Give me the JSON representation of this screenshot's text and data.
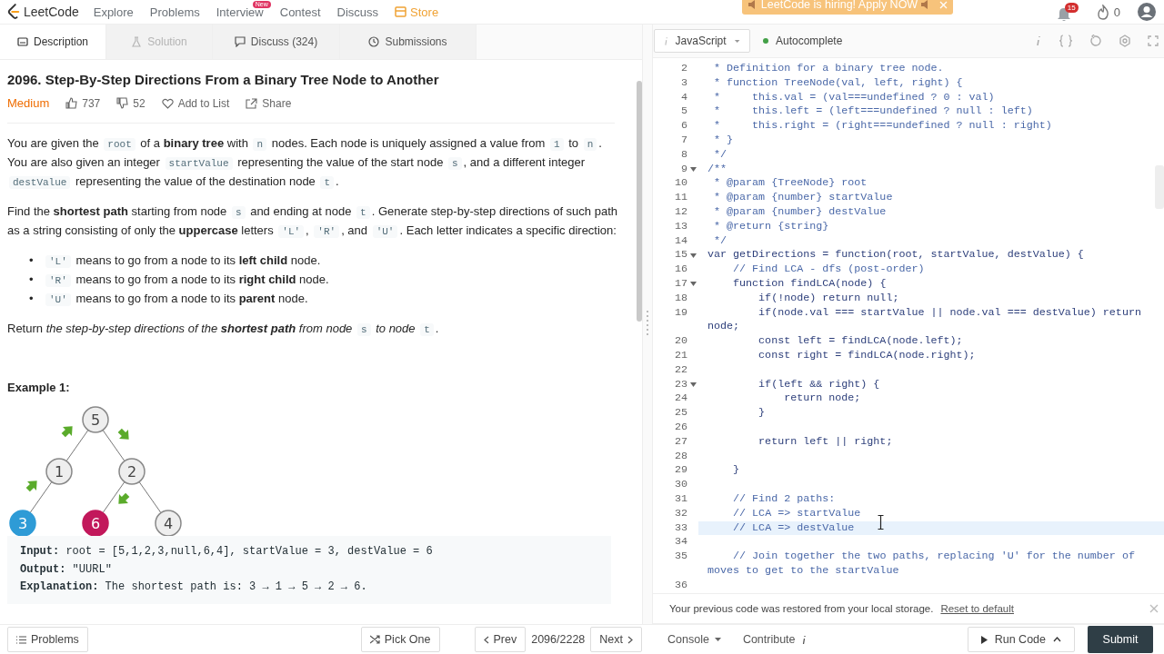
{
  "nav": {
    "brand": "LeetCode",
    "links": [
      {
        "label": "Explore",
        "kind": "link"
      },
      {
        "label": "Problems",
        "kind": "link"
      },
      {
        "label": "Interview",
        "kind": "link",
        "badge": "New"
      },
      {
        "label": "Contest",
        "kind": "link"
      },
      {
        "label": "Discuss",
        "kind": "link"
      },
      {
        "label": "Store",
        "kind": "store"
      }
    ],
    "banner": "LeetCode is hiring! Apply NOW",
    "notifications": "15",
    "streak": "0"
  },
  "tabs": [
    {
      "label": "Description",
      "kind": "description",
      "selected": true,
      "disabled": false
    },
    {
      "label": "Solution",
      "kind": "solution",
      "selected": false,
      "disabled": true
    },
    {
      "label": "Discuss (324)",
      "kind": "discuss",
      "selected": false,
      "disabled": false
    },
    {
      "label": "Submissions",
      "kind": "submissions",
      "selected": false,
      "disabled": false
    }
  ],
  "problem": {
    "title": "2096. Step-By-Step Directions From a Binary Tree Node to Another",
    "difficulty": "Medium",
    "likes": "737",
    "dislikes": "52",
    "add_to_list": "Add to List",
    "share": "Share",
    "paragraphs": [
      [
        {
          "kind": "text",
          "text": "You are given the "
        },
        {
          "kind": "code",
          "text": "root"
        },
        {
          "kind": "text",
          "text": " of a **binary tree** with "
        },
        {
          "kind": "code",
          "text": "n"
        },
        {
          "kind": "text",
          "text": " nodes. Each node is uniquely assigned a value from "
        },
        {
          "kind": "code",
          "text": "1"
        },
        {
          "kind": "text",
          "text": " to "
        },
        {
          "kind": "code",
          "text": "n"
        },
        {
          "kind": "text",
          "text": ". You are also given an integer "
        },
        {
          "kind": "code",
          "text": "startValue"
        },
        {
          "kind": "text",
          "text": " representing the value of the start node "
        },
        {
          "kind": "code",
          "text": "s"
        },
        {
          "kind": "text",
          "text": ", and a different integer "
        },
        {
          "kind": "code",
          "text": "destValue"
        },
        {
          "kind": "text",
          "text": " representing the value of the destination node "
        },
        {
          "kind": "code",
          "text": "t"
        },
        {
          "kind": "text",
          "text": "."
        }
      ],
      [
        {
          "kind": "text",
          "text": "Find the **shortest path** starting from node "
        },
        {
          "kind": "code",
          "text": "s"
        },
        {
          "kind": "text",
          "text": " and ending at node "
        },
        {
          "kind": "code",
          "text": "t"
        },
        {
          "kind": "text",
          "text": ". Generate step-by-step directions of such path as a string consisting of only the **uppercase** letters "
        },
        {
          "kind": "code",
          "text": "'L'"
        },
        {
          "kind": "text",
          "text": ", "
        },
        {
          "kind": "code",
          "text": "'R'"
        },
        {
          "kind": "text",
          "text": ", and "
        },
        {
          "kind": "code",
          "text": "'U'"
        },
        {
          "kind": "text",
          "text": ". Each letter indicates a specific direction:"
        }
      ]
    ],
    "bullets": [
      {
        "marker": "•",
        "segments": [
          {
            "kind": "code",
            "text": "'L'"
          },
          {
            "kind": "text",
            "text": " means to go from a node to its **left child** node."
          }
        ]
      },
      {
        "marker": "•",
        "segments": [
          {
            "kind": "code",
            "text": "'R'"
          },
          {
            "kind": "text",
            "text": " means to go from a node to its **right child** node."
          }
        ]
      },
      {
        "marker": "•",
        "segments": [
          {
            "kind": "code",
            "text": "'U'"
          },
          {
            "kind": "text",
            "text": " means to go from a node to its **parent** node."
          }
        ]
      }
    ],
    "return": [
      {
        "kind": "text",
        "text": "Return "
      },
      {
        "kind": "italic",
        "text": "the step-by-step directions of the **shortest path** from node "
      },
      {
        "kind": "code",
        "text": "s"
      },
      {
        "kind": "italic",
        "text": " to node "
      },
      {
        "kind": "code",
        "text": "t"
      },
      {
        "kind": "text",
        "text": "."
      }
    ],
    "example": {
      "heading": "Example 1:",
      "tree": {
        "label": "5",
        "color": "#eeeeee",
        "children": [
          {
            "label": "1",
            "color": "#eeeeee",
            "kind": "left",
            "children": [
              {
                "label": "3",
                "color": "#2e9bd6",
                "kind": "left"
              }
            ]
          },
          {
            "label": "2",
            "color": "#eeeeee",
            "kind": "right",
            "children": [
              {
                "label": "6",
                "color": "#c2185b",
                "kind": "left"
              },
              {
                "label": "4",
                "color": "#eeeeee",
                "kind": "right"
              }
            ]
          }
        ]
      },
      "lines": [
        {
          "label": "Input:",
          "value": "root = [5,1,2,3,null,6,4], startValue = 3, destValue = 6"
        },
        {
          "label": "Output:",
          "value": "\"UURL\""
        },
        {
          "label": "Explanation:",
          "value": "The shortest path is: 3 → 1 → 5 → 2 → 6."
        }
      ]
    }
  },
  "editor": {
    "language": "JavaScript",
    "autocomplete": "Autocomplete",
    "autocomplete_on": true,
    "lines": [
      {
        "number": "2",
        "text": " * Definition for a binary tree node.",
        "kind": "comment",
        "fold": false,
        "active": false
      },
      {
        "number": "3",
        "text": " * function TreeNode(val, left, right) {",
        "kind": "comment",
        "fold": false,
        "active": false
      },
      {
        "number": "4",
        "text": " *     this.val = (val===undefined ? 0 : val)",
        "kind": "comment",
        "fold": false,
        "active": false
      },
      {
        "number": "5",
        "text": " *     this.left = (left===undefined ? null : left)",
        "kind": "comment",
        "fold": false,
        "active": false
      },
      {
        "number": "6",
        "text": " *     this.right = (right===undefined ? null : right)",
        "kind": "comment",
        "fold": false,
        "active": false
      },
      {
        "number": "7",
        "text": " * }",
        "kind": "comment",
        "fold": false,
        "active": false
      },
      {
        "number": "8",
        "text": " */",
        "kind": "comment",
        "fold": false,
        "active": false
      },
      {
        "number": "9",
        "text": "/**",
        "kind": "comment",
        "fold": true,
        "active": false
      },
      {
        "number": "10",
        "text": " * @param {TreeNode} root",
        "kind": "comment",
        "fold": false,
        "active": false
      },
      {
        "number": "11",
        "text": " * @param {number} startValue",
        "kind": "comment",
        "fold": false,
        "active": false
      },
      {
        "number": "12",
        "text": " * @param {number} destValue",
        "kind": "comment",
        "fold": false,
        "active": false
      },
      {
        "number": "13",
        "text": " * @return {string}",
        "kind": "comment",
        "fold": false,
        "active": false
      },
      {
        "number": "14",
        "text": " */",
        "kind": "comment",
        "fold": false,
        "active": false
      },
      {
        "number": "15",
        "text": "var getDirections = function(root, startValue, destValue) {",
        "kind": "code",
        "fold": true,
        "active": false
      },
      {
        "number": "16",
        "text": "    // Find LCA - dfs (post-order)",
        "kind": "comment",
        "fold": false,
        "active": false
      },
      {
        "number": "17",
        "text": "    function findLCA(node) {",
        "kind": "code",
        "fold": true,
        "active": false
      },
      {
        "number": "18",
        "text": "        if(!node) return null;",
        "kind": "code",
        "fold": false,
        "active": false
      },
      {
        "number": "19",
        "text": "        if(node.val === startValue || node.val === destValue) return node;",
        "kind": "code",
        "fold": false,
        "active": false
      },
      {
        "number": "20",
        "text": "        const left = findLCA(node.left);",
        "kind": "code",
        "fold": false,
        "active": false
      },
      {
        "number": "21",
        "text": "        const right = findLCA(node.right);",
        "kind": "code",
        "fold": false,
        "active": false
      },
      {
        "number": "22",
        "kind": "blank",
        "fold": false,
        "active": false
      },
      {
        "number": "23",
        "text": "        if(left && right) {",
        "kind": "code",
        "fold": true,
        "active": false
      },
      {
        "number": "24",
        "text": "            return node;",
        "kind": "code",
        "fold": false,
        "active": false
      },
      {
        "number": "25",
        "text": "        }",
        "kind": "code",
        "fold": false,
        "active": false
      },
      {
        "number": "26",
        "kind": "blank",
        "fold": false,
        "active": false
      },
      {
        "number": "27",
        "text": "        return left || right;",
        "kind": "code",
        "fold": false,
        "active": false
      },
      {
        "number": "28",
        "kind": "blank",
        "fold": false,
        "active": false
      },
      {
        "number": "29",
        "text": "    }",
        "kind": "code",
        "fold": false,
        "active": false
      },
      {
        "number": "30",
        "kind": "blank",
        "fold": false,
        "active": false
      },
      {
        "number": "31",
        "text": "    // Find 2 paths:",
        "kind": "comment",
        "fold": false,
        "active": false
      },
      {
        "number": "32",
        "text": "    // LCA => startValue",
        "kind": "comment",
        "fold": false,
        "active": false
      },
      {
        "number": "33",
        "text": "    // LCA => destValue",
        "kind": "comment",
        "fold": false,
        "active": true
      },
      {
        "number": "34",
        "kind": "blank",
        "fold": false,
        "active": false
      },
      {
        "number": "35",
        "text": "    // Join together the two paths, replacing 'U' for the number of moves to get to the startValue",
        "kind": "comment",
        "fold": false,
        "active": false
      },
      {
        "number": "36",
        "kind": "blank",
        "fold": false,
        "active": false
      }
    ],
    "notice": "Your previous code was restored from your local storage.",
    "notice_link": "Reset to default"
  },
  "bottom": {
    "problems": "Problems",
    "pick_one": "Pick One",
    "prev": "Prev",
    "position": "2096/2228",
    "next": "Next",
    "console": "Console",
    "contribute": "Contribute",
    "run": "Run Code",
    "submit": "Submit"
  }
}
